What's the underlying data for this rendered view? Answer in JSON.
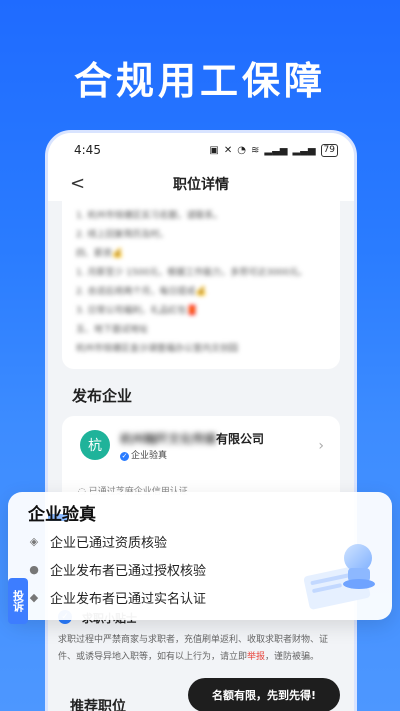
{
  "headline": "合规用工保障",
  "status": {
    "time": "4:45",
    "battery": "79"
  },
  "nav": {
    "back": "<",
    "title": "职位详情"
  },
  "description_lines": [
    "1. 杭州市钱塘区实习名额，请联系。",
    "2. 线上回复简历及时。",
    "四、薪资💰",
    "1. 月薪至少 1500元，根据工作能力，多劳可达3000元。",
    "2. 合适后将两个月，每日提成💰",
    "3. 日常公司福利，礼品红包🧧",
    "五、地下面试地址",
    "杭州市钱塘区金沙湖壹福办公室内文创园"
  ],
  "company_section": {
    "title": "发布企业",
    "logo": "杭",
    "name_blurred": "杭州翰阡文化传媒",
    "name_suffix": "有限公司",
    "verify_tag": "企业验真",
    "credit_note": "已通过芝麻企业信用认证"
  },
  "overlay": {
    "title": "企业验真",
    "items": [
      {
        "icon": "diamond-icon",
        "glyph": "◈",
        "label": "企业已通过资质核验"
      },
      {
        "icon": "user-icon",
        "glyph": "●",
        "label": "企业发布者已通过授权核验"
      },
      {
        "icon": "shield-icon",
        "glyph": "◆",
        "label": "企业发布者已通过实名认证"
      }
    ]
  },
  "side_tab": "投诉",
  "tips": {
    "title": "求职小贴士",
    "body_pre": "求职过程中严禁商家与求职者，充值刷单返利、收取求职者财物、证件、或诱导异地入职等，如有以上行为，请立即",
    "report": "举报",
    "body_post": "，谨防被骗。"
  },
  "recommend_title": "推荐职位",
  "toast": "名额有限，先到先得!"
}
